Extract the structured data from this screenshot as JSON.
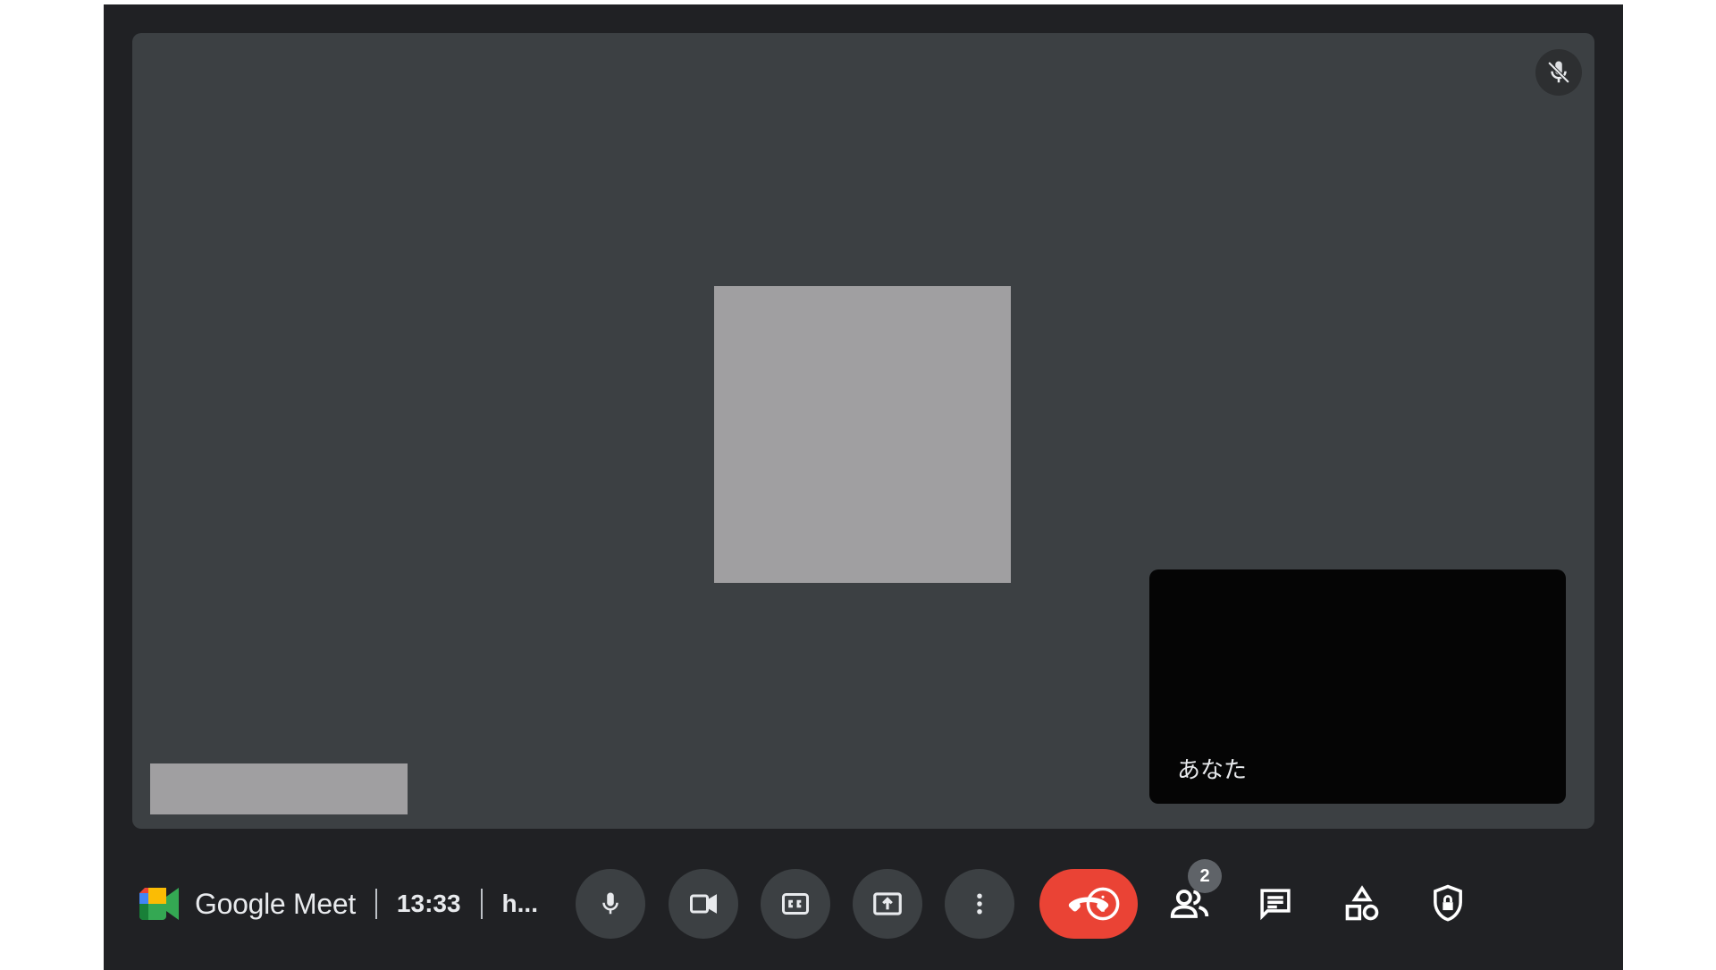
{
  "meeting": {
    "brand_name": "Google Meet",
    "time": "13:33",
    "code": "h..."
  },
  "self_tile": {
    "name": "あなた"
  },
  "participants": {
    "count": "2"
  },
  "colors": {
    "background": "#202124",
    "stage": "#3c4043",
    "control": "#3c4043",
    "end_call": "#ea4335",
    "text": "#e8eaed",
    "badge": "#5f6368"
  },
  "icons": {
    "tile_status": "mic-off-icon",
    "controls": [
      "mic-icon",
      "camera-icon",
      "captions-icon",
      "present-icon",
      "more-options-icon",
      "end-call-icon"
    ],
    "side": [
      "info-icon",
      "people-icon",
      "chat-icon",
      "activities-icon",
      "host-controls-icon"
    ]
  }
}
